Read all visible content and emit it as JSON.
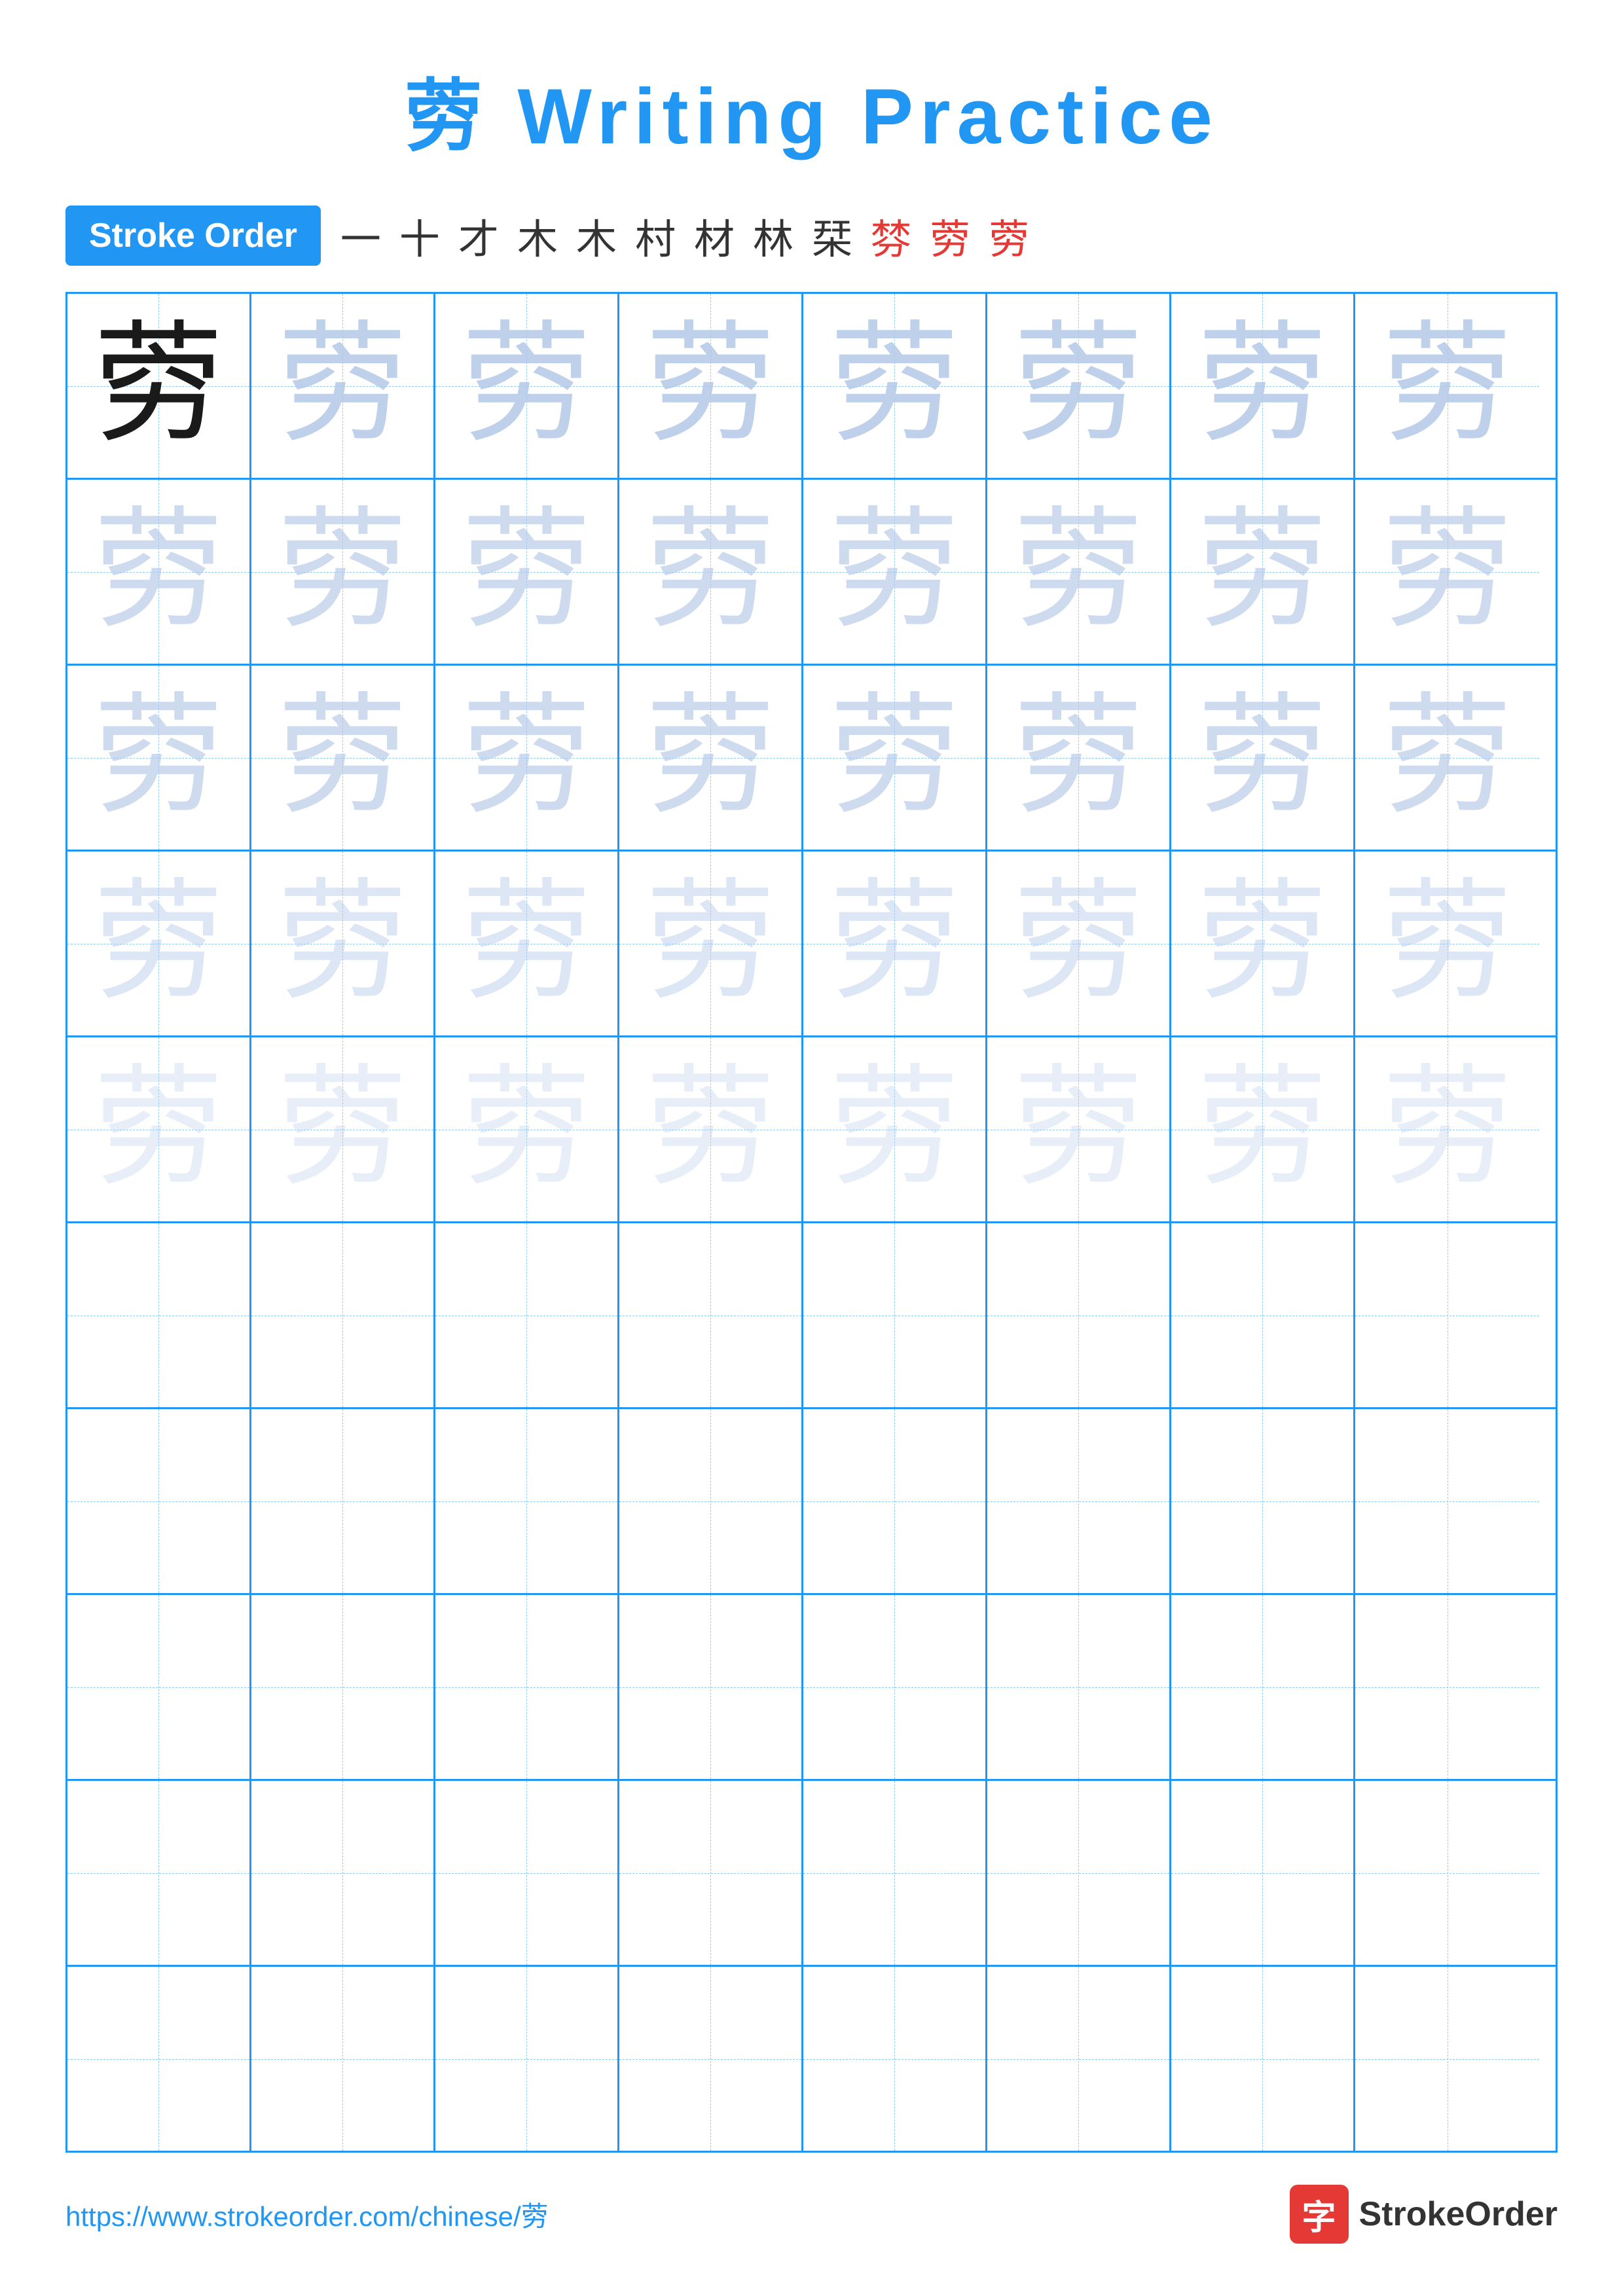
{
  "page": {
    "title_char": "䓖",
    "title_text": "Writing Practice",
    "stroke_order_badge": "Stroke Order",
    "stroke_sequence": [
      "一",
      "十",
      "才",
      "木",
      "木",
      "村",
      "材",
      "林",
      "栞",
      "棼",
      "䓖",
      "䓖"
    ],
    "red_indices": [
      9,
      10
    ],
    "character": "䓖",
    "footer_url": "https://www.strokeorder.com/chinese/䓖",
    "footer_logo_char": "字",
    "footer_logo_name": "StrokeOrder"
  },
  "grid": {
    "rows": 10,
    "cols": 8
  }
}
